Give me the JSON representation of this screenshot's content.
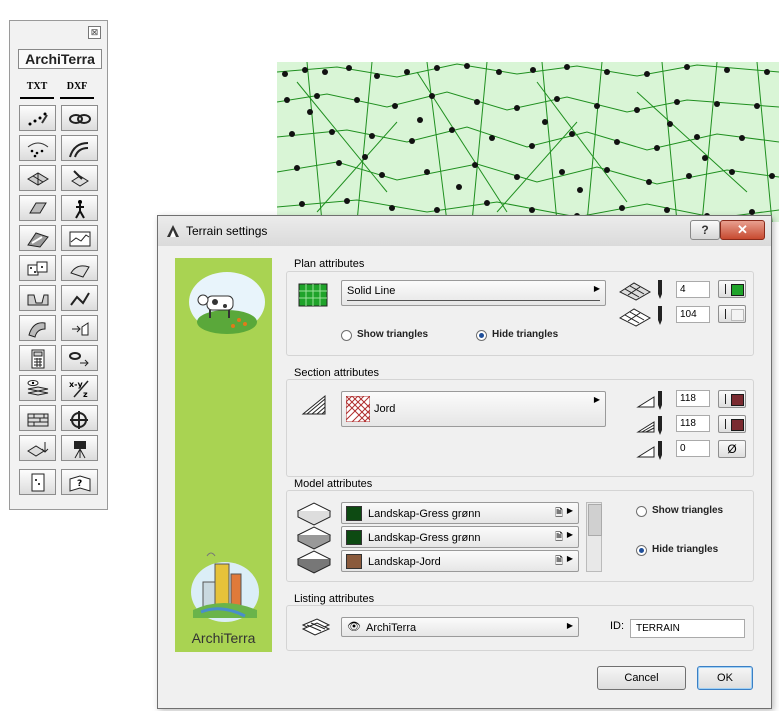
{
  "palette": {
    "close_glyph": "⊠",
    "logo": "ArchiTerra",
    "txt_label": "TXT",
    "dxf_label": "DXF"
  },
  "dialog": {
    "title": "Terrain settings",
    "help_glyph": "?",
    "close_glyph": "✕",
    "brand": "ArchiTerra",
    "plan": {
      "title": "Plan attributes",
      "line_type": "Solid Line",
      "pen_top": "4",
      "pen_bottom": "104",
      "show_triangles": "Show triangles",
      "hide_triangles": "Hide triangles",
      "selected": "hide",
      "pen_top_color": "#1fa32a"
    },
    "section": {
      "title": "Section attributes",
      "fill": "Jord",
      "pen1": "118",
      "pen2": "118",
      "pen3": "0",
      "empty_glyph": "Ø",
      "pen_color": "#7a2a30"
    },
    "model": {
      "title": "Model attributes",
      "materials": [
        {
          "name": "Landskap-Gress grønn",
          "color": "#0d4a12"
        },
        {
          "name": "Landskap-Gress grønn",
          "color": "#0d4a12"
        },
        {
          "name": "Landskap-Jord",
          "color": "#8a5a3c"
        }
      ],
      "show_triangles": "Show triangles",
      "hide_triangles": "Hide triangles",
      "selected": "hide"
    },
    "listing": {
      "title": "Listing attributes",
      "layer": "ArchiTerra",
      "id_label": "ID:",
      "id_value": "TERRAIN"
    },
    "buttons": {
      "cancel": "Cancel",
      "ok": "OK"
    }
  }
}
